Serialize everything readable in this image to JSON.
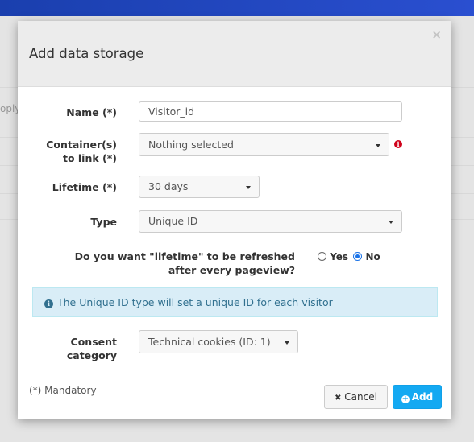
{
  "background": {
    "partial_text": "oply"
  },
  "modal": {
    "title": "Add data storage",
    "close_glyph": "×",
    "fields": {
      "name": {
        "label": "Name (*)",
        "value": "Visitor_id"
      },
      "containers": {
        "label": "Container(s) to link (*)",
        "value": "Nothing selected",
        "info_glyph": "i"
      },
      "lifetime": {
        "label": "Lifetime (*)",
        "value": "30 days"
      },
      "type": {
        "label": "Type",
        "value": "Unique ID"
      },
      "refresh": {
        "label": "Do you want \"lifetime\" to be refreshed after every pageview?",
        "yes_label": "Yes",
        "no_label": "No",
        "selected": "No"
      },
      "consent": {
        "label": "Consent category",
        "value": "Technical cookies (ID: 1)"
      }
    },
    "alert": {
      "icon_glyph": "i",
      "text": "The Unique ID type will set a unique ID for each visitor"
    },
    "footer": {
      "mandatory_note": "(*) Mandatory",
      "cancel_glyph": "✖",
      "cancel_label": "Cancel",
      "add_glyph": "+",
      "add_label": "Add"
    }
  },
  "colors": {
    "topbar": "#1a3fae",
    "primary_button": "#14a9f2",
    "alert_bg": "#d9edf7",
    "alert_text": "#31708f",
    "required_info": "#d0021b"
  },
  "icons": {
    "close": "close-icon",
    "info": "info-icon",
    "cancel": "times-icon",
    "add": "plus-circle-icon",
    "caret": "caret-down-icon"
  }
}
